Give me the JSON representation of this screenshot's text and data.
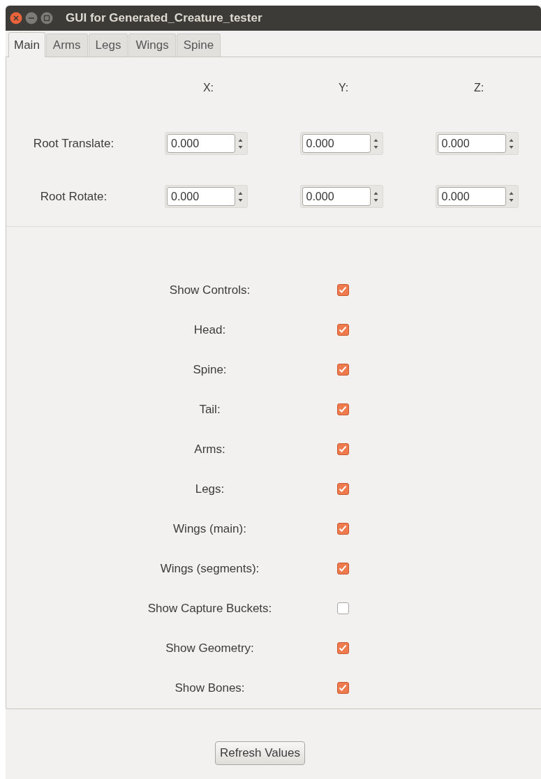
{
  "window": {
    "title": "GUI for Generated_Creature_tester"
  },
  "tabs": [
    {
      "label": "Main",
      "selected": true
    },
    {
      "label": "Arms",
      "selected": false
    },
    {
      "label": "Legs",
      "selected": false
    },
    {
      "label": "Wings",
      "selected": false
    },
    {
      "label": "Spine",
      "selected": false
    }
  ],
  "axes": [
    "X:",
    "Y:",
    "Z:"
  ],
  "transform_rows": [
    {
      "label": "Root Translate:",
      "values": [
        "0.000",
        "0.000",
        "0.000"
      ]
    },
    {
      "label": "Root Rotate:",
      "values": [
        "0.000",
        "0.000",
        "0.000"
      ]
    }
  ],
  "toggles": [
    {
      "label": "Show Controls:",
      "checked": true
    },
    {
      "label": "Head:",
      "checked": true
    },
    {
      "label": "Spine:",
      "checked": true
    },
    {
      "label": "Tail:",
      "checked": true
    },
    {
      "label": "Arms:",
      "checked": true
    },
    {
      "label": "Legs:",
      "checked": true
    },
    {
      "label": "Wings (main):",
      "checked": true
    },
    {
      "label": "Wings (segments):",
      "checked": true
    },
    {
      "label": "Show Capture Buckets:",
      "checked": false
    },
    {
      "label": "Show Geometry:",
      "checked": true
    },
    {
      "label": "Show Bones:",
      "checked": true
    }
  ],
  "button": "Refresh Values"
}
